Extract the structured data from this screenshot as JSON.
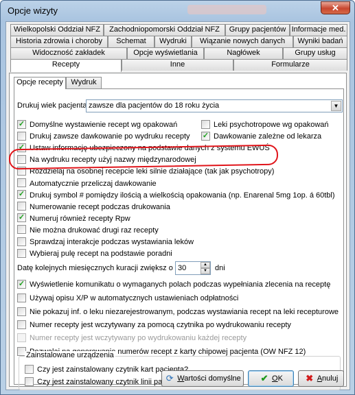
{
  "window": {
    "title": "Opcje wizyty",
    "close_glyph": "✕"
  },
  "tabs_row1": [
    "Wielkopolski Oddział NFZ",
    "Zachodniopomorski Oddział NFZ",
    "Grupy pacjentów",
    "Informacje med."
  ],
  "tabs_row2": [
    "Historia zdrowia i choroby",
    "Schemat",
    "Wydruki",
    "Wiązanie nowych danych",
    "Wyniki badań"
  ],
  "tabs_row3": [
    "Widoczność zakładek",
    "Opcje wyświetlania",
    "Nagłówek",
    "Grupy usług"
  ],
  "tabs_row4": [
    "Recepty",
    "Inne",
    "Formularze"
  ],
  "subtabs": [
    "Opcje recepty",
    "Wydruk"
  ],
  "print_age": {
    "label": "Drukuj wiek pacjenta:",
    "value": "zawsze dla pacjentów do 18 roku życia"
  },
  "options_left": [
    {
      "label": "Domyślne wystawienie recept wg opakowań",
      "checked": true
    },
    {
      "label": "Drukuj zawsze dawkowanie po wydruku recepty",
      "checked": false
    },
    {
      "label": "Ustaw informację ubezpieczony na podstawie danych z systemu EWUŚ",
      "checked": true
    },
    {
      "label": "Na wydruku recepty użyj nazwy międzynarodowej",
      "checked": false
    },
    {
      "label": "Rozdzielaj na osobnej recepcie leki silnie działające (tak jak psychotropy)",
      "checked": false
    },
    {
      "label": "Automatycznie przeliczaj dawkowanie",
      "checked": false
    },
    {
      "label": "Drukuj symbol # pomiędzy ilością a wielkością opakowania (np. Enarenal 5mg 1op. á 60tbl)",
      "checked": true
    },
    {
      "label": "Numerowanie recept podczas drukowania",
      "checked": false
    },
    {
      "label": "Numeruj również recepty Rpw",
      "checked": true
    },
    {
      "label": "Nie można drukować drugi raz recepty",
      "checked": false
    },
    {
      "label": "Sprawdzaj interakcje podczas wystawiania leków",
      "checked": false
    },
    {
      "label": "Wybieraj pulę recept na podstawie poradni",
      "checked": false
    }
  ],
  "options_right": [
    {
      "label": "Leki psychotropowe wg opakowań",
      "checked": false
    },
    {
      "label": "Dawkowanie zależne od lekarza",
      "checked": true
    }
  ],
  "monthly": {
    "label": "Datę kolejnych miesięcznych kuracji  zwiększ o",
    "value": "30",
    "unit": "dni"
  },
  "options_lower": [
    {
      "label": "Wyświetlenie komunikatu o wymaganych polach podczas wypełniania zlecenia na receptę",
      "checked": true,
      "disabled": false
    },
    {
      "label": "Używaj opisu X/P w automatycznych ustawieniach odpłatności",
      "checked": false,
      "disabled": false
    },
    {
      "label": "Nie pokazuj inf. o leku niezarejestrowanym, podczas wystawiania recept na leki recepturowe",
      "checked": false,
      "disabled": false
    },
    {
      "label": "Numer recepty jest wczytywany za pomocą czytnika po wydrukowaniu recepty",
      "checked": false,
      "disabled": false
    },
    {
      "label": "Numer recepty jest wczytywany po wydrukowaniu każdej recepty",
      "checked": false,
      "disabled": true
    },
    {
      "label": "Pozwalaj na generowanie numerów recept z karty chipowej pacjenta  (OW NFZ 12)",
      "checked": false,
      "disabled": false
    }
  ],
  "devices": {
    "title": "Zainstalowane urządzenia",
    "items": [
      "Czy jest zainstalowany czytnik kart pacjenta?",
      "Czy jest zainstalowany czytnik linii papilarnych?"
    ]
  },
  "buttons": {
    "defaults": {
      "label": "Wartości domyślne",
      "hotkey": "W",
      "rest": "artości domyślne"
    },
    "ok": {
      "label": "OK",
      "hotkey": "O",
      "rest": "K"
    },
    "cancel": {
      "label": "Anuluj",
      "hotkey": "A",
      "rest": "nuluj"
    }
  },
  "colors": {
    "accent_highlight": "#e0141a",
    "check_green": "#21a121"
  }
}
